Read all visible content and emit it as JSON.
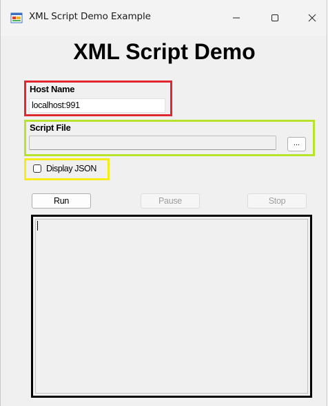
{
  "window": {
    "title": "XML Script Demo Example",
    "minimize_glyph": "—",
    "maximize_glyph": "☐",
    "close_glyph": "✕",
    "icon": "app-window-icon"
  },
  "heading": "XML Script Demo",
  "host": {
    "label": "Host Name",
    "value": "localhost:991"
  },
  "script": {
    "label": "Script File",
    "value": "",
    "browse_label": "..."
  },
  "options": {
    "display_json_label": "Display JSON",
    "display_json_checked": false
  },
  "buttons": {
    "run": "Run",
    "pause": "Pause",
    "stop": "Stop"
  },
  "output": {
    "text": ""
  },
  "highlight_colors": {
    "host": "#e0262e",
    "script": "#b7e32c",
    "json": "#f7ec18",
    "output": "#000000"
  }
}
